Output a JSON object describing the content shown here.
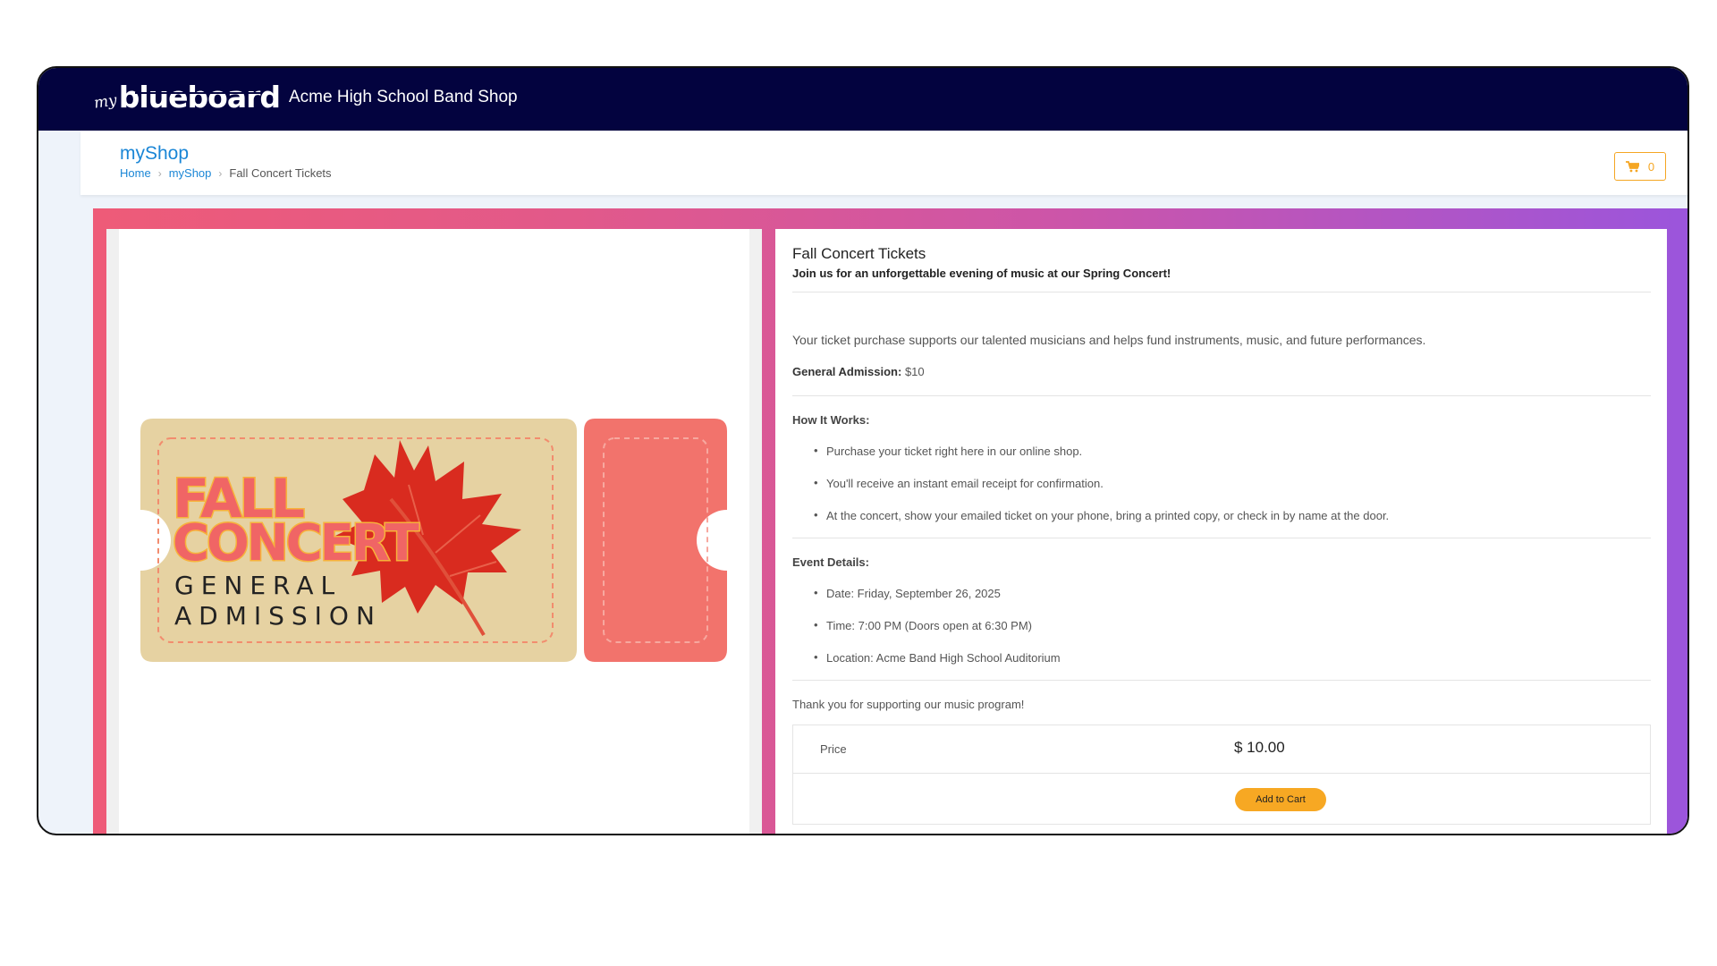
{
  "topbar": {
    "logo_my": "my",
    "logo_brand": "blueboard",
    "shop_title": "Acme High School Band Shop",
    "color": "#03033f"
  },
  "header": {
    "title": "myShop",
    "breadcrumb": [
      "Home",
      "myShop",
      "Fall Concert Tickets"
    ],
    "cart_count": "0"
  },
  "ticket_image": {
    "line1": "FALL",
    "line2": "CONCERT",
    "line3": "GENERAL",
    "line4": "ADMISSION",
    "colors": {
      "ticket": "#e6d2a2",
      "stub": "#f2736c",
      "title": "#f06565",
      "leaf": "#d92b1f"
    }
  },
  "product": {
    "name": "Fall Concert Tickets",
    "tagline": "Join us for an unforgettable evening of music at our Spring Concert!",
    "support_text": "Your ticket purchase supports our talented musicians and helps fund instruments, music, and future performances.",
    "ga_label": "General Admission:",
    "ga_value": " $10",
    "how_heading": "How It Works:",
    "how_items": [
      "Purchase your ticket right here in our online shop.",
      "You'll receive an instant email receipt for confirmation.",
      "At the concert, show your emailed ticket on your phone, bring a printed copy, or check in by name at the door."
    ],
    "event_heading": "Event Details:",
    "event_items": [
      "Date: Friday, September 26, 2025",
      "Time: 7:00 PM (Doors open at 6:30 PM)",
      "Location: Acme Band High School Auditorium"
    ],
    "thanks": "Thank you for supporting our music program!",
    "price_label": "Price",
    "price_value": "$ 10.00",
    "add_button": "Add to Cart"
  }
}
